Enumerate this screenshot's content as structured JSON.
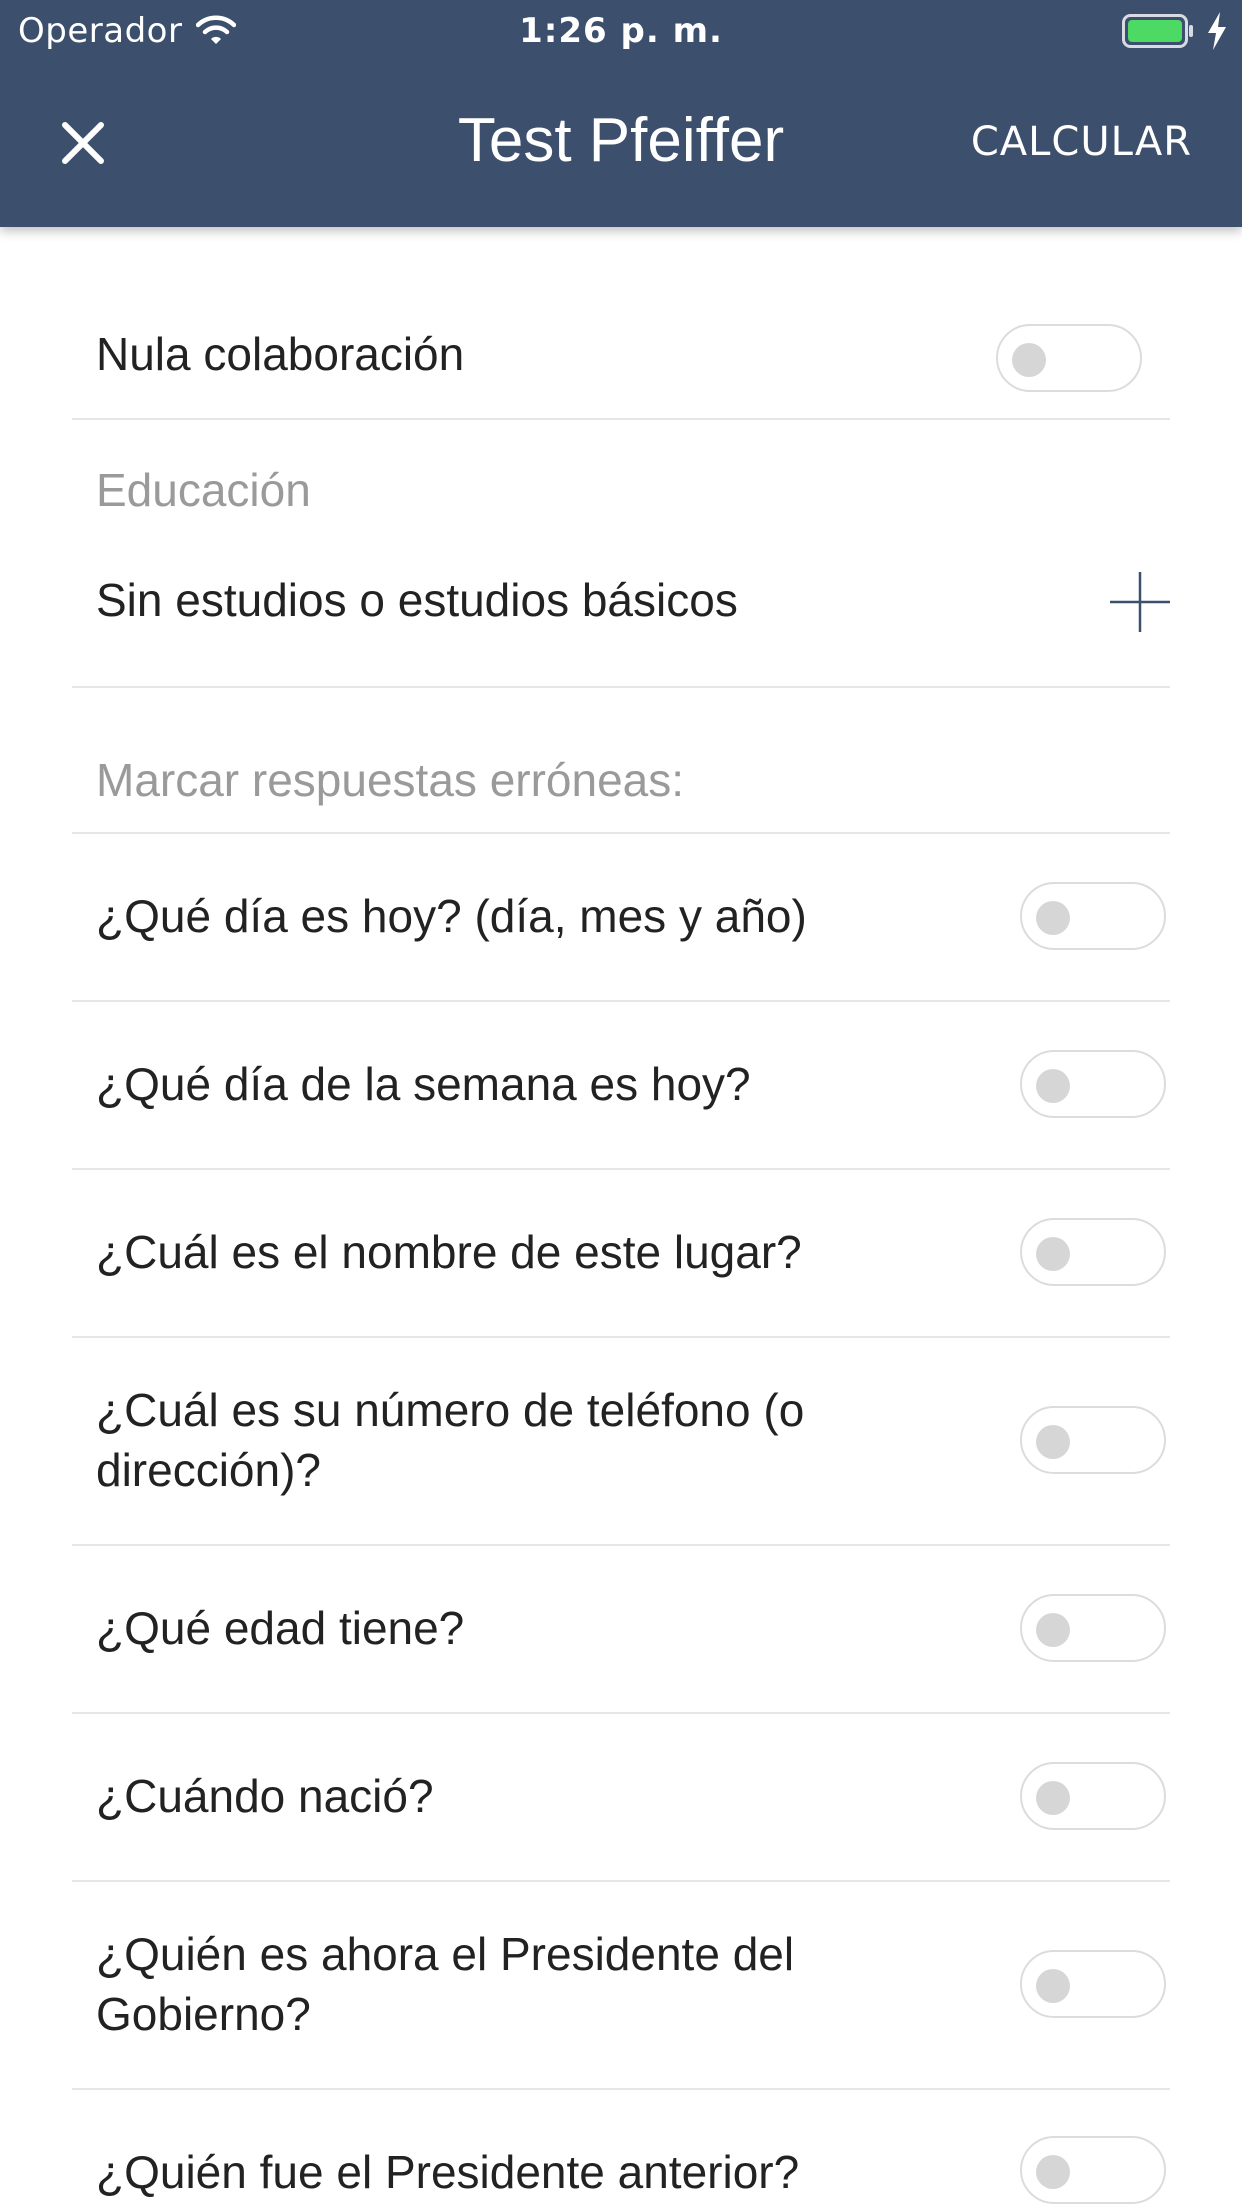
{
  "status_bar": {
    "carrier": "Operador",
    "time": "1:26 p. m.",
    "wifi_icon": "wifi-icon",
    "battery_icon": "battery-icon",
    "charging_icon": "charging-bolt-icon",
    "battery_color": "#4cd964"
  },
  "nav": {
    "close_icon": "close-icon",
    "title": "Test Pfeiffer",
    "calculate_label": "CALCULAR",
    "background": "#3c4f6d"
  },
  "form": {
    "no_collaboration": {
      "label": "Nula colaboración",
      "on": false
    },
    "education": {
      "label": "Educación",
      "value": "Sin estudios o estudios básicos",
      "add_icon": "plus-icon"
    },
    "wrong_answers_label": "Marcar respuestas erróneas:",
    "questions": [
      {
        "label": "¿Qué día es hoy? (día, mes y año)",
        "on": false
      },
      {
        "label": "¿Qué día de la semana es hoy?",
        "on": false
      },
      {
        "label": "¿Cuál es el nombre de este lugar?",
        "on": false
      },
      {
        "label": "¿Cuál es su número de teléfono (o dirección)?",
        "on": false
      },
      {
        "label": "¿Qué edad tiene?",
        "on": false
      },
      {
        "label": "¿Cuándo nació?",
        "on": false
      },
      {
        "label": "¿Quién es ahora el Presidente del Gobierno?",
        "on": false
      },
      {
        "label": "¿Quién fue el Presidente anterior?",
        "on": false
      }
    ]
  }
}
